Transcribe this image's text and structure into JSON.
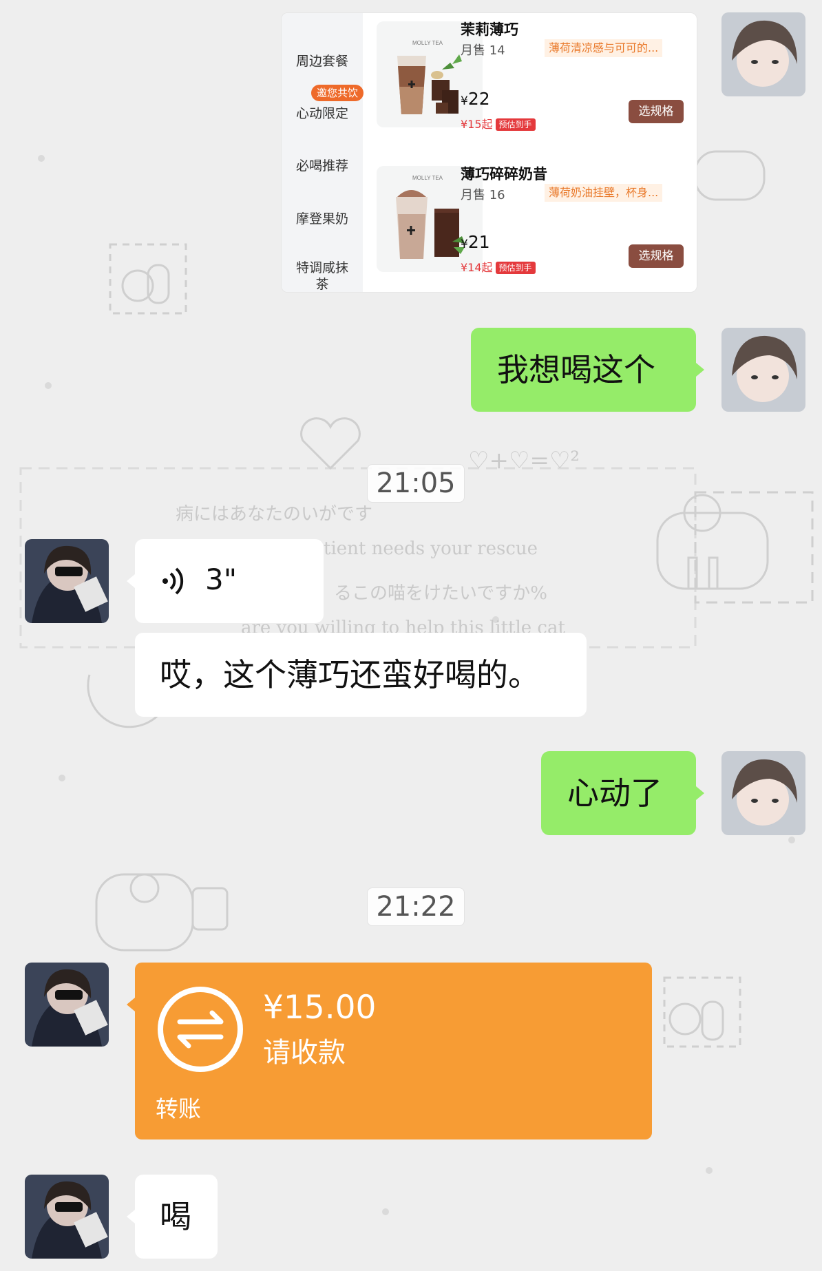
{
  "colors": {
    "sent_bubble": "#95ec69",
    "received_bubble": "#ffffff",
    "transfer_bubble": "#f79c34",
    "spec_button": "#8a4d40",
    "promo_orange": "#e9792a",
    "estimate_red": "#e4393c"
  },
  "background": {
    "text_line1": "病にはあなたのいがです",
    "text_line2": "tient needs your rescue",
    "text_line3": "るこの喵をけたいですか%",
    "text_line4": "are you willing to help this little cat",
    "heart_formula": "♡+♡=♡²"
  },
  "shop_card": {
    "sidebar": [
      "周边套餐",
      "心动限定",
      "必喝推荐",
      "摩登果奶",
      "特调咸抹茶"
    ],
    "sidebar_badge": "邀您共饮",
    "products": [
      {
        "name": "茉莉薄巧",
        "sales": "月售 14",
        "desc": "薄荷清凉感与可可的...",
        "price_symbol": "¥",
        "price": "22",
        "estimate": "¥15起",
        "estimate_tag": "预估到手",
        "button": "选规格",
        "brand": "MOLLY TEA"
      },
      {
        "name": "薄巧碎碎奶昔",
        "sales": "月售 16",
        "desc": "薄荷奶油挂壁，杯身...",
        "price_symbol": "¥",
        "price": "21",
        "estimate": "¥14起",
        "estimate_tag": "预估到手",
        "button": "选规格",
        "brand": "MOLLY TEA"
      }
    ]
  },
  "messages": {
    "msg1": "我想喝这个",
    "time1": "21:05",
    "voice_duration": "3\"",
    "msg2": "哎，这个薄巧还蛮好喝的。",
    "msg3": "心动了",
    "time2": "21:22",
    "transfer_amount": "¥15.00",
    "transfer_label": "请收款",
    "transfer_kind": "转账",
    "msg4": "喝"
  },
  "icons": {
    "voice": "voice-wave-icon",
    "transfer": "transfer-arrows-icon"
  }
}
